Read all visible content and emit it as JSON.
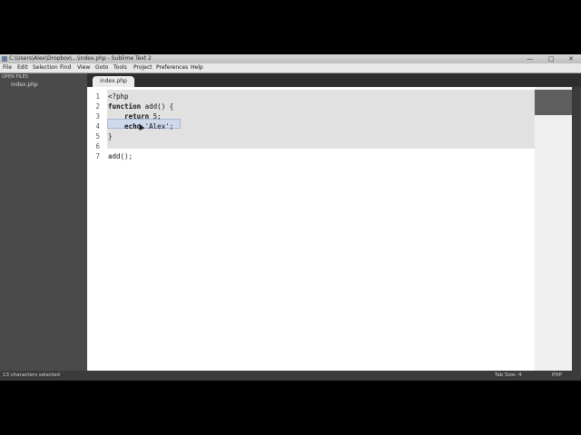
{
  "window": {
    "title": "C:\\Users\\Alex\\Dropbox\\...\\index.php - Sublime Text 2",
    "controls": [
      "—",
      "□",
      "✕"
    ]
  },
  "menu": [
    "File",
    "Edit",
    "Selection",
    "Find",
    "View",
    "Goto",
    "Tools",
    "Project",
    "Preferences",
    "Help"
  ],
  "sidebar": {
    "open_files_header": "OPEN FILES",
    "files": [
      "index.php"
    ]
  },
  "tab": {
    "label": "index.php"
  },
  "editor": {
    "lines": [
      {
        "n": "1",
        "text": "<?php"
      },
      {
        "n": "2",
        "keyword": "function",
        "text": " add() {"
      },
      {
        "n": "3",
        "keyword": "    return",
        "text": " 5;"
      },
      {
        "n": "4",
        "keyword": "    echo",
        "text": " 'Alex';"
      },
      {
        "n": "5",
        "text": "}"
      },
      {
        "n": "6",
        "text": ""
      },
      {
        "n": "7",
        "text": "add();"
      }
    ]
  },
  "status": {
    "left": "13 characters selected",
    "tab_size": "Tab Size: 4",
    "syntax": "PHP"
  }
}
